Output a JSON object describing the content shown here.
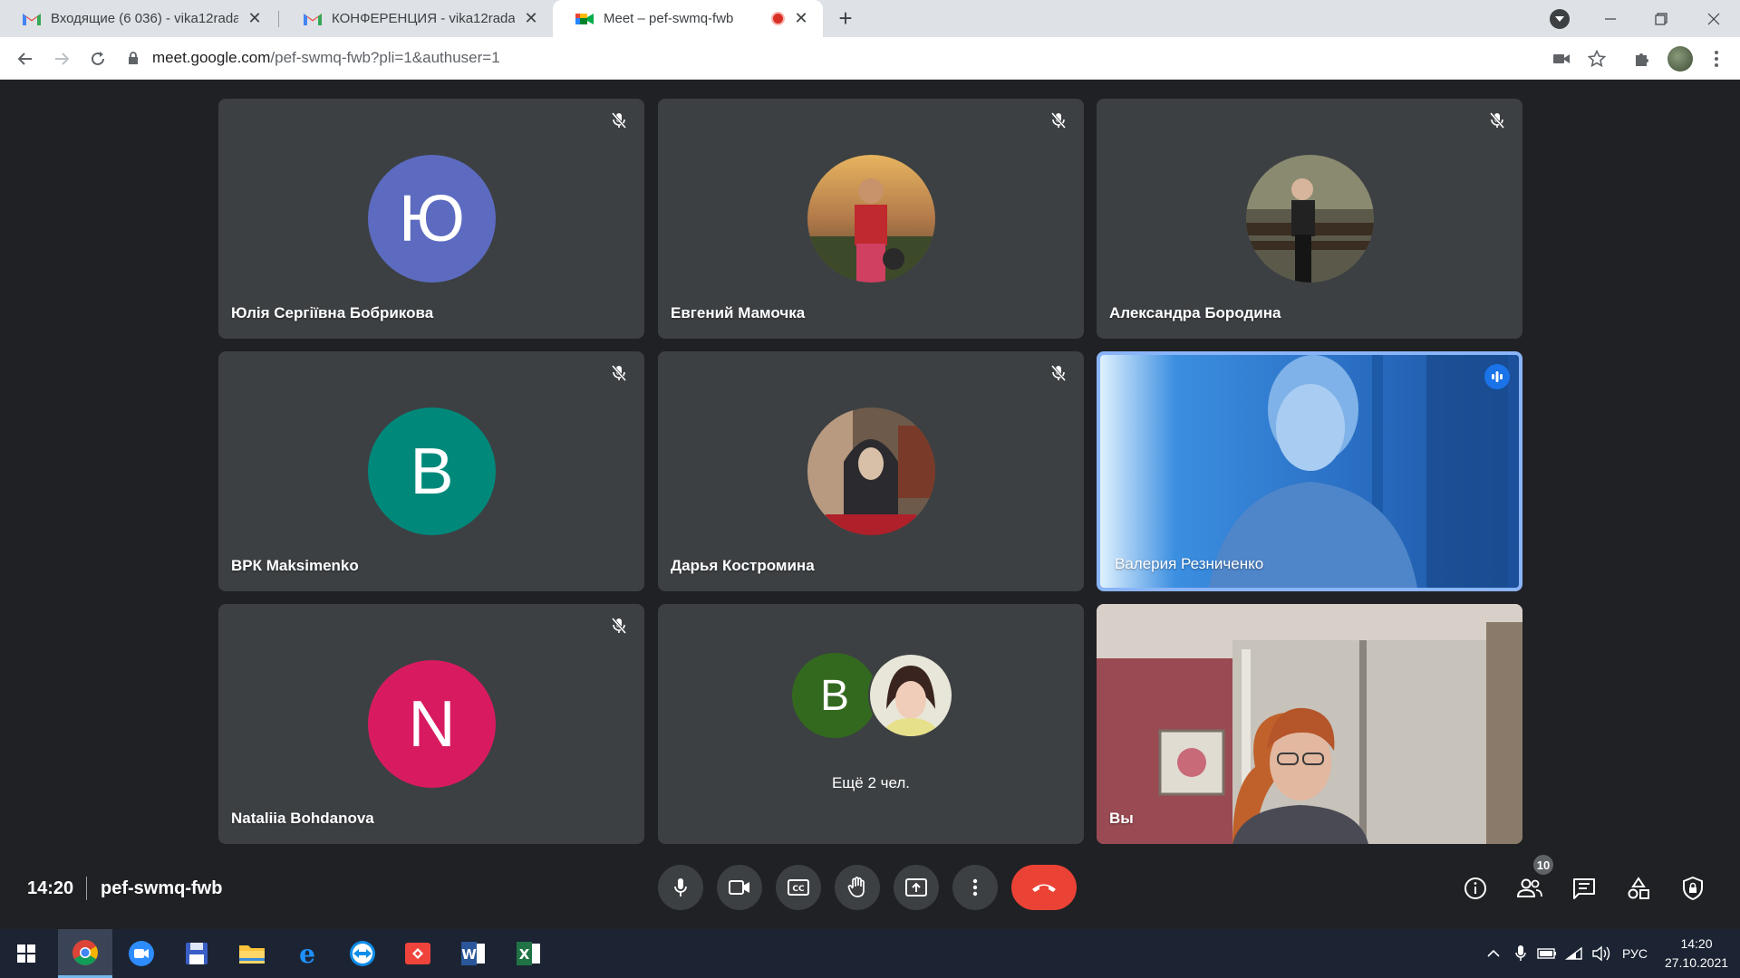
{
  "browser": {
    "tabs": [
      {
        "title": "Входящие (6 036) - vika12rada@",
        "icon": "gmail-icon"
      },
      {
        "title": "КОНФЕРЕНЦИЯ - vika12rada@g",
        "icon": "gmail-icon"
      },
      {
        "title": "Meet – pef-swmq-fwb",
        "icon": "meet-icon",
        "recording": true
      }
    ],
    "url_domain": "meet.google.com",
    "url_path": "/pef-swmq-fwb?pli=1&authuser=1"
  },
  "meeting": {
    "time": "14:20",
    "code": "pef-swmq-fwb",
    "participants_count": "10",
    "participants": [
      {
        "name": "Юлія Сергіївна Бобрикова",
        "initial": "Ю",
        "color": "#5c6bc0",
        "muted": true
      },
      {
        "name": "Евгений Мамочка",
        "photo": true,
        "muted": true
      },
      {
        "name": "Александра Бородина",
        "photo": true,
        "muted": true
      },
      {
        "name": "ВРК Maksimenko",
        "initial": "В",
        "color": "#00897b",
        "muted": true
      },
      {
        "name": "Дарья Костромина",
        "photo": true,
        "muted": true
      },
      {
        "name": "Валерия Резниченко",
        "video": true,
        "speaking": true
      },
      {
        "name": "Nataliia Bohdanova",
        "initial": "N",
        "color": "#d81b60",
        "muted": true
      },
      {
        "name": "Ещё 2 чел.",
        "initial": "В",
        "color": "#33691e",
        "group": true
      },
      {
        "name": "Вы",
        "video": true
      }
    ]
  },
  "taskbar": {
    "apps": [
      "windows-start",
      "chrome",
      "zoom",
      "save-app",
      "file-explorer",
      "edge",
      "teamviewer",
      "anydesk",
      "word",
      "excel"
    ],
    "language": "РУС",
    "time": "14:20",
    "date": "27.10.2021"
  }
}
